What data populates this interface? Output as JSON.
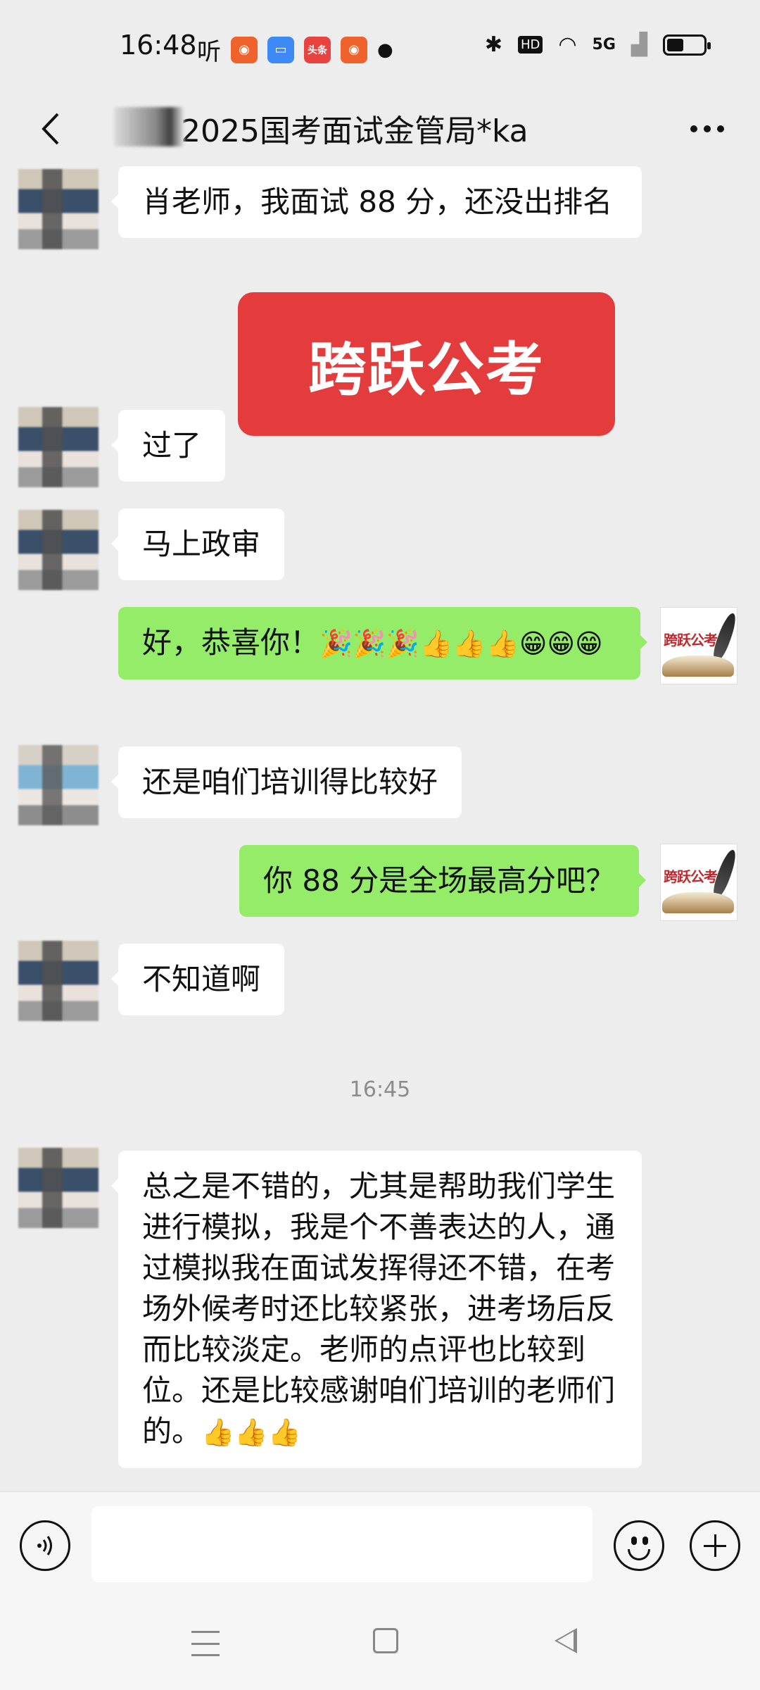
{
  "status_bar": {
    "time": "16:48",
    "app_icons": [
      {
        "name": "ting-app",
        "label": "听",
        "color": "#111111"
      },
      {
        "name": "kuaishou-app",
        "label": "",
        "color": "#f0622c"
      },
      {
        "name": "blue-app",
        "label": "",
        "color": "#3d8af7"
      },
      {
        "name": "toutiao-app",
        "label": "头条",
        "color": "#e8433f"
      },
      {
        "name": "kuaishou-lite-app",
        "label": "",
        "color": "#f0622c"
      }
    ],
    "network": "5G",
    "hd_label": "HD",
    "battery_level": 0.45
  },
  "header": {
    "title": "2025国考面试金管局*ka"
  },
  "messages": [
    {
      "side": "left",
      "text": "肖老师，我面试 88 分，还没出排名"
    },
    {
      "side": "left",
      "type": "sticker",
      "text": "跨跃公考"
    },
    {
      "side": "left",
      "text": "过了"
    },
    {
      "side": "left",
      "text": "马上政审"
    },
    {
      "side": "right",
      "text": "好，恭喜你！",
      "emojis": "🎉🎉🎉👍👍👍😁😁😁"
    },
    {
      "side": "left",
      "text": "还是咱们培训得比较好"
    },
    {
      "side": "right",
      "text": "你 88 分是全场最高分吧？"
    },
    {
      "side": "left",
      "text": "不知道啊"
    },
    {
      "side": "left",
      "text": "总之是不错的，尤其是帮助我们学生进行模拟，我是个不善表达的人，通过模拟我在面试发挥得还不错，在考场外候考时还比较紧张，进考场后反而比较淡定。老师的点评也比较到位。还是比较感谢咱们培训的老师们的。",
      "emojis": "👍👍👍"
    }
  ],
  "timestamp": "16:45",
  "avatar_logo_text": "跨跃公考",
  "colors": {
    "background": "#ededed",
    "bubble_left": "#ffffff",
    "bubble_right": "#95ec69",
    "sticker": "#e43c3c"
  },
  "icons": {
    "back": "chevron-left-icon",
    "more": "more-dots-icon",
    "voice": "voice-icon",
    "emoji": "smile-icon",
    "plus": "plus-icon"
  }
}
